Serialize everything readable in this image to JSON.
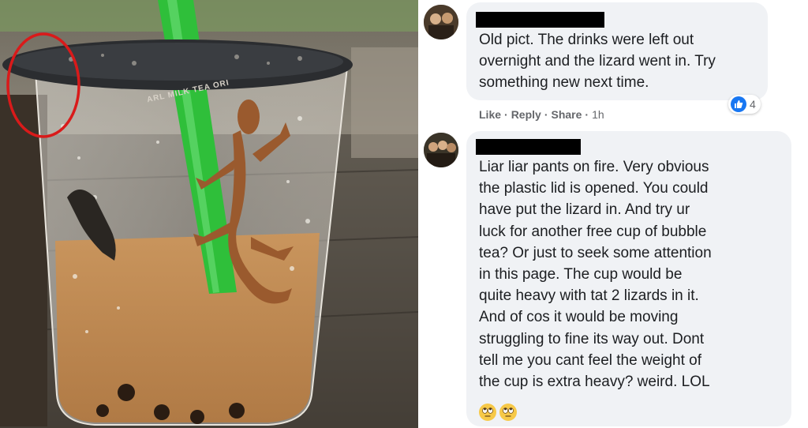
{
  "photo": {
    "lid_label": "ARL MILK TEA ORI",
    "annotation_color": "#d91a1a"
  },
  "comments": [
    {
      "author": "",
      "text": "Old pict. The drinks were left out\novernight and the lizard went in. Try\nsomething new next time.",
      "actions": {
        "like": "Like",
        "reply": "Reply",
        "share": "Share",
        "time": "1h"
      },
      "reaction_count": "4"
    },
    {
      "author": "",
      "text": "Liar liar pants on fire. Very obvious\nthe plastic lid is opened. You could\nhave put the lizard in. And try ur\nluck for another free cup of bubble\ntea? Or just to seek some attention\nin this page. The cup would be\nquite heavy with tat 2 lizards in it.\nAnd of cos it would be moving\nstruggling to fine its way out. Dont\ntell me you cant feel the weight of\nthe cup is extra heavy? weird. LOL",
      "emojis": [
        "rolling-eyes-face",
        "rolling-eyes-face"
      ]
    }
  ],
  "colors": {
    "bubble": "#f0f2f5",
    "text": "#1c1e21",
    "meta": "#65676b",
    "like_blue": "#1877f2"
  }
}
